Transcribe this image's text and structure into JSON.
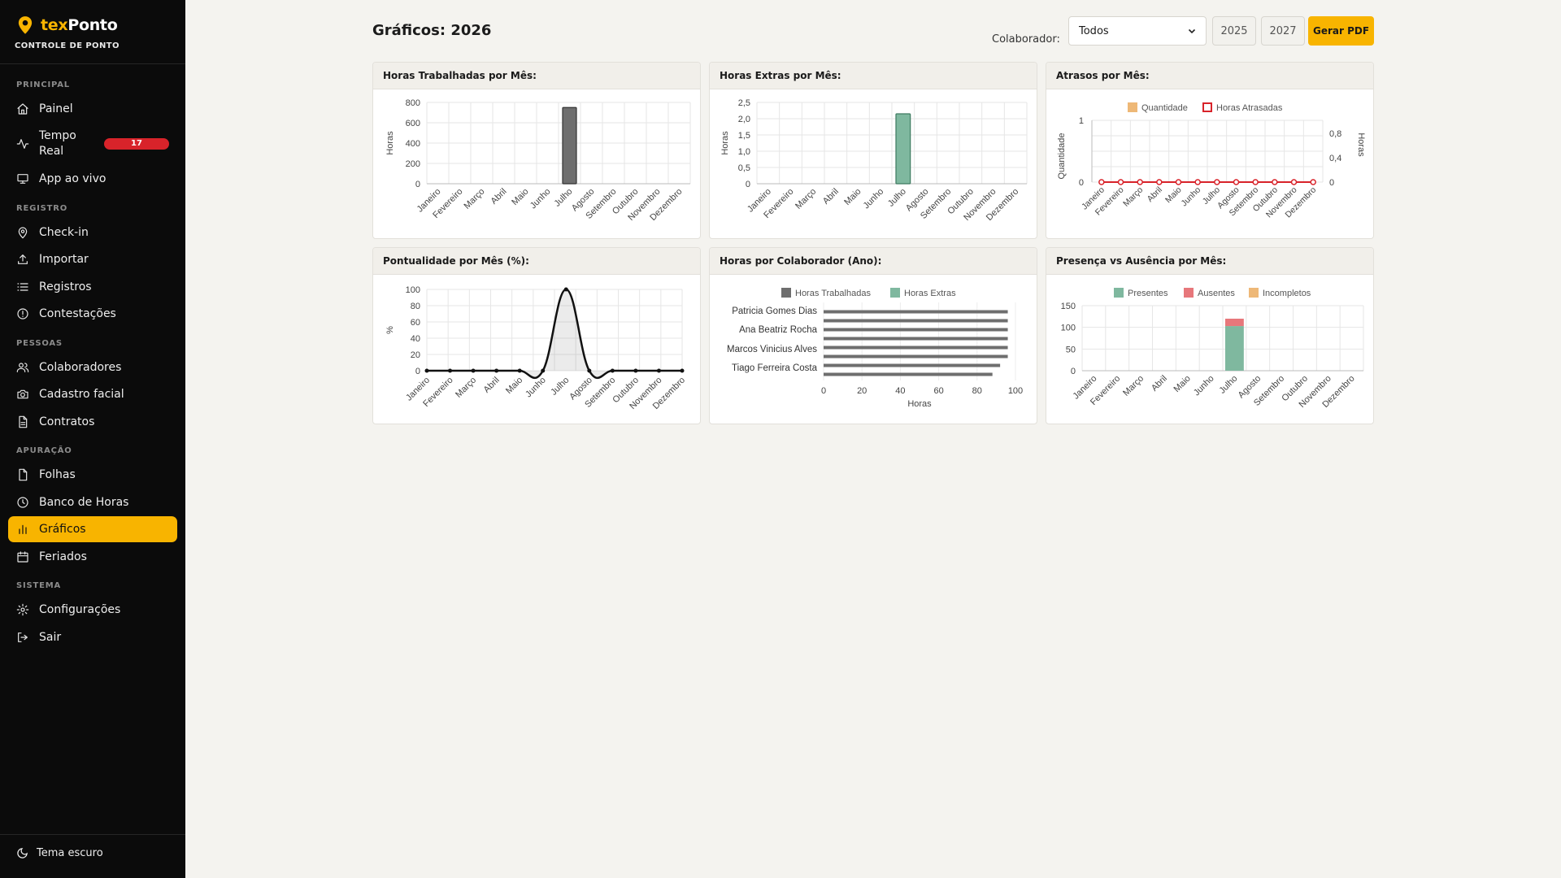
{
  "brand": {
    "name_a": "tex",
    "name_b": "Ponto",
    "subtitle": "CONTROLE DE PONTO"
  },
  "nav": {
    "sections": [
      {
        "title": "PRINCIPAL",
        "items": [
          {
            "label": "Painel",
            "icon": "home-icon"
          },
          {
            "label": "Tempo Real",
            "icon": "activity-icon",
            "badge": "17"
          },
          {
            "label": "App ao vivo",
            "icon": "monitor-icon"
          }
        ]
      },
      {
        "title": "REGISTRO",
        "items": [
          {
            "label": "Check-in",
            "icon": "map-pin-icon"
          },
          {
            "label": "Importar",
            "icon": "upload-icon"
          },
          {
            "label": "Registros",
            "icon": "list-icon"
          },
          {
            "label": "Contestações",
            "icon": "alert-circle-icon"
          }
        ]
      },
      {
        "title": "PESSOAS",
        "items": [
          {
            "label": "Colaboradores",
            "icon": "users-icon"
          },
          {
            "label": "Cadastro facial",
            "icon": "camera-icon"
          },
          {
            "label": "Contratos",
            "icon": "file-text-icon"
          }
        ]
      },
      {
        "title": "APURAÇÃO",
        "items": [
          {
            "label": "Folhas",
            "icon": "file-icon"
          },
          {
            "label": "Banco de Horas",
            "icon": "clock-icon"
          },
          {
            "label": "Gráficos",
            "icon": "bar-chart-icon",
            "active": true
          },
          {
            "label": "Feriados",
            "icon": "calendar-icon"
          }
        ]
      },
      {
        "title": "SISTEMA",
        "items": [
          {
            "label": "Configurações",
            "icon": "gear-icon"
          },
          {
            "label": "Sair",
            "icon": "logout-icon"
          }
        ]
      }
    ],
    "theme_toggle": "Tema escuro"
  },
  "header": {
    "title": "Gráficos: 2026",
    "collaborator_label": "Colaborador:",
    "collaborator_value": "Todos",
    "prev_year": "2025",
    "next_year": "2027",
    "pdf_button": "Gerar PDF"
  },
  "colors": {
    "accent": "#f8b400",
    "worked": "#6e6e6e",
    "extra": "#7fb89f",
    "late": "#d8232a",
    "absent": "#e7777b",
    "incomplete": "#eeb877",
    "presence": "#7fb89f"
  },
  "chart_data": [
    {
      "id": "worked",
      "type": "bar",
      "title": "Horas Trabalhadas por Mês:",
      "ylabel": "Horas",
      "ylim": [
        0,
        800
      ],
      "yticks": [
        "0",
        "200",
        "400",
        "600",
        "800"
      ],
      "categories": [
        "Janeiro",
        "Fevereiro",
        "Março",
        "Abril",
        "Maio",
        "Junho",
        "Julho",
        "Agosto",
        "Setembro",
        "Outubro",
        "Novembro",
        "Dezembro"
      ],
      "values": [
        0,
        0,
        0,
        0,
        0,
        0,
        750,
        0,
        0,
        0,
        0,
        0
      ]
    },
    {
      "id": "extra",
      "type": "bar",
      "title": "Horas Extras por Mês:",
      "ylabel": "Horas",
      "ylim": [
        0,
        2.5
      ],
      "yticks": [
        "0",
        "0,5",
        "1,0",
        "1,5",
        "2,0",
        "2,5"
      ],
      "categories": [
        "Janeiro",
        "Fevereiro",
        "Março",
        "Abril",
        "Maio",
        "Junho",
        "Julho",
        "Agosto",
        "Setembro",
        "Outubro",
        "Novembro",
        "Dezembro"
      ],
      "values": [
        0,
        0,
        0,
        0,
        0,
        0,
        2.15,
        0,
        0,
        0,
        0,
        0
      ]
    },
    {
      "id": "late",
      "type": "line",
      "title": "Atrasos por Mês:",
      "ylabel": "Quantidade",
      "ylabel_right": "Horas",
      "yticks_left": [
        "0",
        "1"
      ],
      "yticks_right": [
        "0",
        "0,4",
        "0,8"
      ],
      "legend": [
        "Quantidade",
        "Horas Atrasadas"
      ],
      "categories": [
        "Janeiro",
        "Fevereiro",
        "Março",
        "Abril",
        "Maio",
        "Junho",
        "Julho",
        "Agosto",
        "Setembro",
        "Outubro",
        "Novembro",
        "Dezembro"
      ],
      "series": [
        {
          "name": "Quantidade",
          "values": [
            0,
            0,
            0,
            0,
            0,
            0,
            0,
            0,
            0,
            0,
            0,
            0
          ]
        },
        {
          "name": "Horas Atrasadas",
          "values": [
            0,
            0,
            0,
            0,
            0,
            0,
            0,
            0,
            0,
            0,
            0,
            0
          ]
        }
      ]
    },
    {
      "id": "punctuality",
      "type": "area",
      "title": "Pontualidade por Mês (%):",
      "ylabel": "%",
      "ylim": [
        0,
        100
      ],
      "yticks": [
        "0",
        "20",
        "40",
        "60",
        "80",
        "100"
      ],
      "categories": [
        "Janeiro",
        "Fevereiro",
        "Março",
        "Abril",
        "Maio",
        "Junho",
        "Julho",
        "Agosto",
        "Setembro",
        "Outubro",
        "Novembro",
        "Dezembro"
      ],
      "values": [
        0,
        0,
        0,
        0,
        0,
        0,
        100,
        0,
        0,
        0,
        0,
        0
      ]
    },
    {
      "id": "per_collaborator",
      "type": "bar",
      "orientation": "horizontal",
      "title": "Horas por Colaborador (Ano):",
      "xlabel": "Horas",
      "xlim": [
        0,
        100
      ],
      "xticks": [
        "0",
        "20",
        "40",
        "60",
        "80",
        "100"
      ],
      "legend": [
        "Horas Trabalhadas",
        "Horas Extras"
      ],
      "categories": [
        "Patricia Gomes Dias",
        "Ana Beatriz Rocha",
        "Marcos Vinicius Alves",
        "Tiago Ferreira Costa"
      ],
      "series": [
        {
          "name": "Horas Trabalhadas",
          "values": [
            96,
            96,
            96,
            92
          ]
        },
        {
          "name": "Horas Extras",
          "values": [
            96,
            96,
            96,
            88
          ]
        }
      ]
    },
    {
      "id": "presence",
      "type": "bar",
      "stacked": true,
      "title": "Presença vs Ausência por Mês:",
      "ylim": [
        0,
        150
      ],
      "yticks": [
        "0",
        "50",
        "100",
        "150"
      ],
      "legend": [
        "Presentes",
        "Ausentes",
        "Incompletos"
      ],
      "categories": [
        "Janeiro",
        "Fevereiro",
        "Março",
        "Abril",
        "Maio",
        "Junho",
        "Julho",
        "Agosto",
        "Setembro",
        "Outubro",
        "Novembro",
        "Dezembro"
      ],
      "series": [
        {
          "name": "Presentes",
          "values": [
            0,
            0,
            0,
            0,
            0,
            0,
            103,
            0,
            0,
            0,
            0,
            0
          ]
        },
        {
          "name": "Ausentes",
          "values": [
            0,
            0,
            0,
            0,
            0,
            0,
            17,
            0,
            0,
            0,
            0,
            0
          ]
        },
        {
          "name": "Incompletos",
          "values": [
            0,
            0,
            0,
            0,
            0,
            0,
            0,
            0,
            0,
            0,
            0,
            0
          ]
        }
      ]
    }
  ]
}
